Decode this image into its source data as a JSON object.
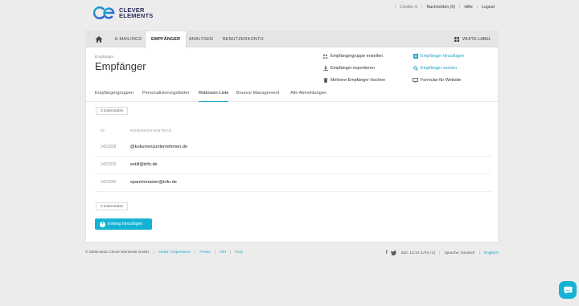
{
  "brand": {
    "line1": "CLEVER",
    "line2": "ELEMENTS"
  },
  "toplinks": {
    "credits": "Credits: 0",
    "messages": "Nachrichten (0)",
    "help": "Hilfe",
    "logout": "Logout"
  },
  "nav": {
    "items": [
      "E-MAILINGS",
      "EMPFÄNGER",
      "ANALYSEN",
      "BENUTZERKONTO"
    ],
    "active": "EMPFÄNGER",
    "whitelabel": "WHITE-LABEL"
  },
  "page": {
    "breadcrumb": "Empfänger",
    "title": "Empfänger"
  },
  "actions_left": [
    "Empfängergruppe erstellen",
    "Empfänger exportieren",
    "Mehrere Empfänger löschen"
  ],
  "actions_right": [
    "Empfänger hinzufügen",
    "Empfänger suchen",
    "Formular für Website"
  ],
  "tabs": [
    "Empfängergruppen",
    "Personalisierungsfelder",
    "Robinson-Liste",
    "Bounce Management",
    "Alle Abmeldungen"
  ],
  "active_tab": "Robinson-Liste",
  "record_count": "3 Datensätze",
  "table": {
    "headers": [
      "ID",
      "ROBINSON-EINTRAG"
    ],
    "rows": [
      {
        "id": "3422838",
        "entry": "@kokurrenzunternehmen.de"
      },
      {
        "id": "3422836",
        "entry": "estill@info.de"
      },
      {
        "id": "3422840",
        "entry": "spammmaster@info.de"
      }
    ]
  },
  "add_button": "Eintrag hinzufügen",
  "footer": {
    "copyright": "© 2005-2022 Clever Elements GmbH",
    "links": [
      "AGBs / Impressum",
      "Preise",
      "API",
      "FAQ"
    ],
    "time": "Zeit: 13:14 (UTC+2)",
    "language_label": "Sprache: Deutsch",
    "language_alt": "Englisch"
  },
  "colors": {
    "accent": "#14b3d6",
    "brand": "#2a2f5b"
  }
}
